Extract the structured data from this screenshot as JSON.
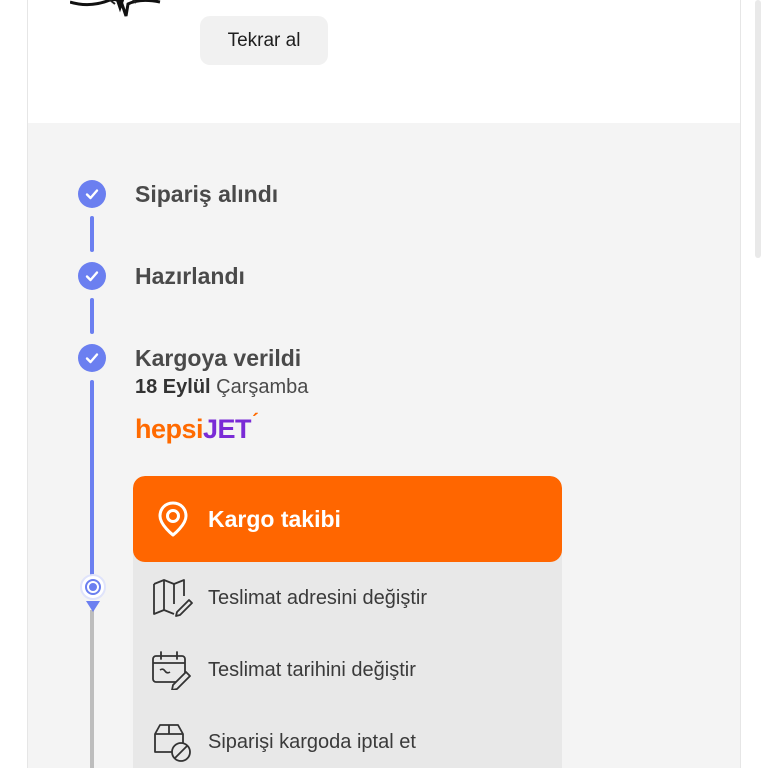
{
  "reorder_button": "Tekrar al",
  "steps": [
    {
      "title": "Sipariş alındı",
      "status": "completed"
    },
    {
      "title": "Hazırlandı",
      "status": "completed"
    },
    {
      "title": "Kargoya verildi",
      "status": "completed",
      "date_bold": "18 Eylül",
      "date_rest": "Çarşamba"
    }
  ],
  "carrier": {
    "name_part1": "hepsi",
    "name_part2": "JET",
    "mark": "´"
  },
  "tracking_button": "Kargo takibi",
  "actions": [
    {
      "label": "Teslimat adresini değiştir",
      "icon": "map-edit-icon"
    },
    {
      "label": "Teslimat tarihini değiştir",
      "icon": "calendar-edit-icon"
    },
    {
      "label": "Siparişi kargoda iptal et",
      "icon": "box-cancel-icon"
    }
  ],
  "colors": {
    "accent": "#ff6600",
    "timeline": "#6b7ff0",
    "carrier_purple": "#7a2bd6"
  }
}
